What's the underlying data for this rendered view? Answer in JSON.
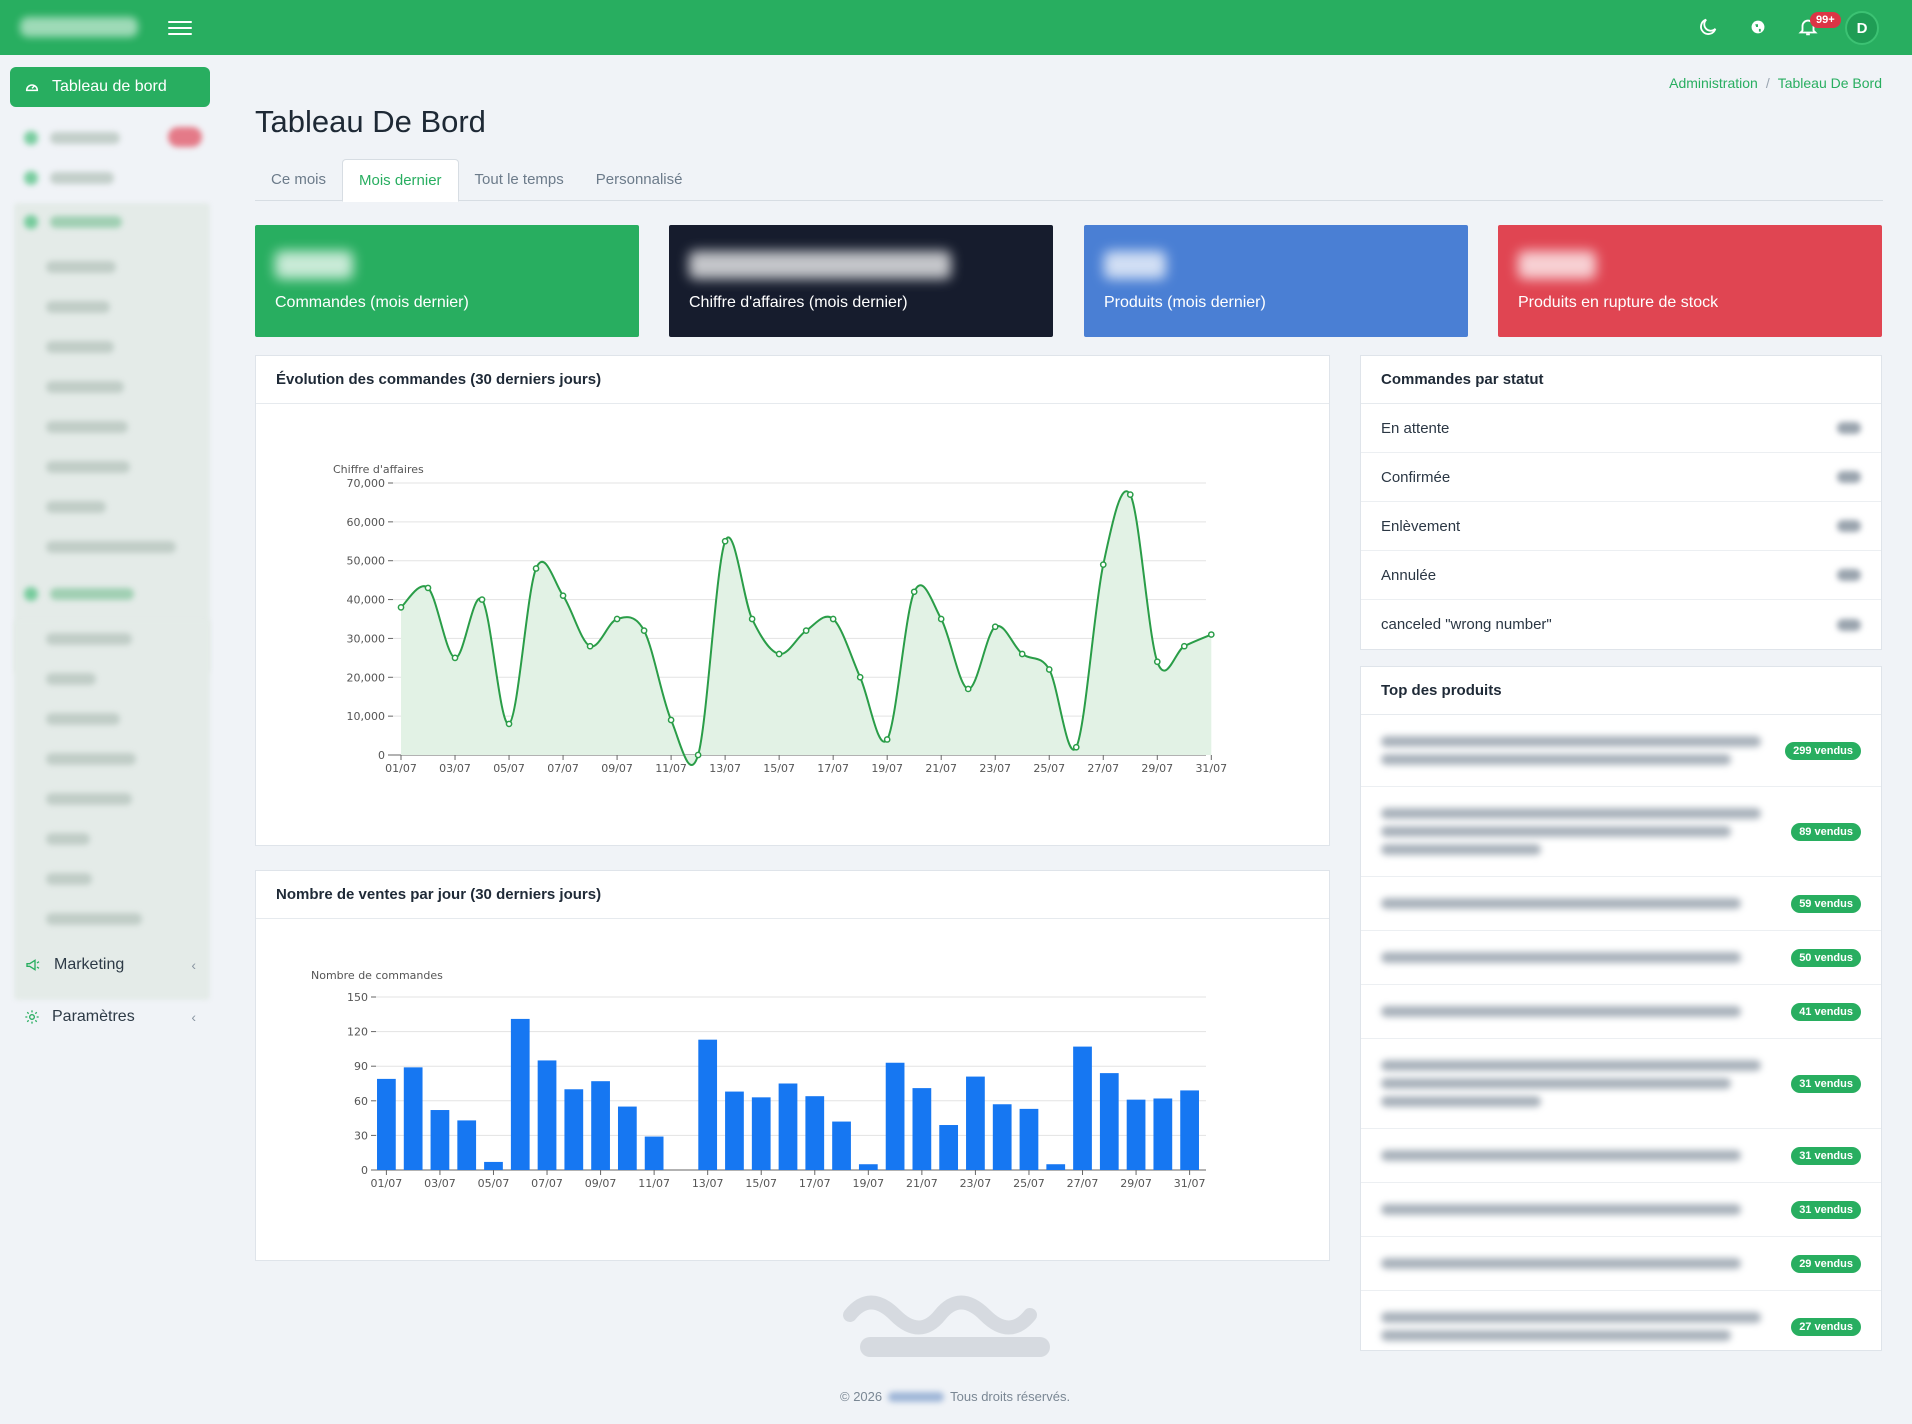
{
  "topbar": {
    "notification_badge": "99+",
    "user_initial": "D"
  },
  "sidebar": {
    "active_label": "Tableau de bord",
    "items": [
      {
        "label": "Marketing",
        "icon": "megaphone-icon"
      },
      {
        "label": "Paramètres",
        "icon": "gear-icon"
      }
    ]
  },
  "breadcrumb": {
    "parent": "Administration",
    "separator": "/",
    "current": "Tableau De Bord"
  },
  "page": {
    "title": "Tableau De Bord"
  },
  "tabs": [
    {
      "label": "Ce mois",
      "active": false
    },
    {
      "label": "Mois dernier",
      "active": true
    },
    {
      "label": "Tout le temps",
      "active": false
    },
    {
      "label": "Personnalisé",
      "active": false
    }
  ],
  "stats": [
    {
      "label": "Commandes (mois dernier)",
      "color": "#28ae60"
    },
    {
      "label": "Chiffre d'affaires (mois dernier)",
      "color": "#161c2d"
    },
    {
      "label": "Produits (mois dernier)",
      "color": "#4a7fd4"
    },
    {
      "label": "Produits en rupture de stock",
      "color": "#e04552"
    }
  ],
  "revenue_panel": {
    "title": "Évolution des commandes (30 derniers jours)"
  },
  "sales_panel": {
    "title": "Nombre de ventes par jour (30 derniers jours)"
  },
  "status_panel": {
    "title": "Commandes par statut",
    "rows": [
      "En attente",
      "Confirmée",
      "Enlèvement",
      "Annulée",
      "canceled \"wrong number\""
    ]
  },
  "top_products": {
    "title": "Top des produits",
    "rows": [
      {
        "sold": "299 vendus",
        "lines": 2
      },
      {
        "sold": "89 vendus",
        "lines": 3
      },
      {
        "sold": "59 vendus",
        "lines": 1
      },
      {
        "sold": "50 vendus",
        "lines": 1
      },
      {
        "sold": "41 vendus",
        "lines": 1
      },
      {
        "sold": "31 vendus",
        "lines": 3
      },
      {
        "sold": "31 vendus",
        "lines": 1
      },
      {
        "sold": "31 vendus",
        "lines": 1
      },
      {
        "sold": "29 vendus",
        "lines": 1
      },
      {
        "sold": "27 vendus",
        "lines": 2
      }
    ]
  },
  "footer": {
    "copyright": "© 2026",
    "rights": "Tous droits réservés."
  },
  "chart_data": [
    {
      "type": "area",
      "ylabel": "Chiffre d'affaires",
      "ylim": [
        0,
        70000
      ],
      "yticks": [
        0,
        10000,
        20000,
        30000,
        40000,
        50000,
        60000,
        70000
      ],
      "ytick_labels": [
        "0",
        "10,000",
        "20,000",
        "30,000",
        "40,000",
        "50,000",
        "60,000",
        "70,000"
      ],
      "x_tick_labels": [
        "01/07",
        "03/07",
        "05/07",
        "07/07",
        "09/07",
        "11/07",
        "13/07",
        "15/07",
        "17/07",
        "19/07",
        "21/07",
        "23/07",
        "25/07",
        "27/07",
        "29/07",
        "31/07"
      ],
      "categories": [
        "01/07",
        "02/07",
        "03/07",
        "04/07",
        "05/07",
        "06/07",
        "07/07",
        "08/07",
        "09/07",
        "10/07",
        "11/07",
        "12/07",
        "13/07",
        "14/07",
        "15/07",
        "16/07",
        "17/07",
        "18/07",
        "19/07",
        "20/07",
        "21/07",
        "22/07",
        "23/07",
        "24/07",
        "25/07",
        "26/07",
        "27/07",
        "28/07",
        "29/07",
        "30/07",
        "31/07"
      ],
      "values": [
        38000,
        43000,
        25000,
        40000,
        8000,
        48000,
        41000,
        28000,
        35000,
        32000,
        9000,
        0,
        55000,
        35000,
        26000,
        32000,
        35000,
        20000,
        4000,
        42000,
        35000,
        17000,
        33000,
        26000,
        22000,
        2000,
        49000,
        67000,
        24000,
        28000,
        31000
      ],
      "color": "#2a9d48",
      "fill": "#e2f2e5",
      "grid": true
    },
    {
      "type": "bar",
      "ylabel": "Nombre de commandes",
      "ylim": [
        0,
        150
      ],
      "yticks": [
        0,
        30,
        60,
        90,
        120,
        150
      ],
      "ytick_labels": [
        "0",
        "30",
        "60",
        "90",
        "120",
        "150"
      ],
      "x_tick_labels": [
        "01/07",
        "03/07",
        "05/07",
        "07/07",
        "09/07",
        "11/07",
        "13/07",
        "15/07",
        "17/07",
        "19/07",
        "21/07",
        "23/07",
        "25/07",
        "27/07",
        "29/07",
        "31/07"
      ],
      "categories": [
        "01/07",
        "02/07",
        "03/07",
        "04/07",
        "05/07",
        "06/07",
        "07/07",
        "08/07",
        "09/07",
        "10/07",
        "11/07",
        "12/07",
        "13/07",
        "14/07",
        "15/07",
        "16/07",
        "17/07",
        "18/07",
        "19/07",
        "20/07",
        "21/07",
        "22/07",
        "23/07",
        "24/07",
        "25/07",
        "26/07",
        "27/07",
        "28/07",
        "29/07",
        "30/07",
        "31/07"
      ],
      "values": [
        79,
        89,
        52,
        43,
        7,
        131,
        95,
        70,
        77,
        55,
        29,
        0,
        113,
        68,
        63,
        75,
        64,
        42,
        5,
        93,
        71,
        39,
        81,
        57,
        53,
        5,
        107,
        84,
        61,
        62,
        69
      ],
      "color": "#1677f2",
      "grid": true
    }
  ]
}
